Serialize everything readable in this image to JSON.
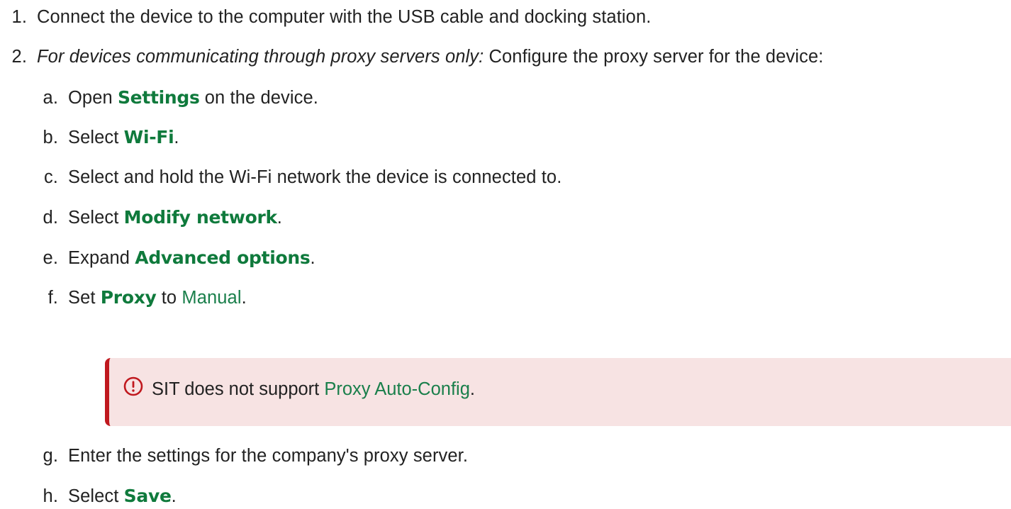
{
  "steps": [
    {
      "number": "1.",
      "text": "Connect the device to the computer with the USB cable and docking station."
    },
    {
      "number": "2.",
      "condition": "For devices communicating through proxy servers only:",
      "text": " Configure the proxy server for the device:",
      "substeps": [
        {
          "letter": "a.",
          "before": "Open ",
          "ui": "Settings",
          "after": " on the device."
        },
        {
          "letter": "b.",
          "before": "Select ",
          "ui": "Wi-Fi",
          "after": "."
        },
        {
          "letter": "c.",
          "text": "Select and hold the Wi-Fi network the device is connected to."
        },
        {
          "letter": "d.",
          "before": "Select ",
          "ui": "Modify network",
          "after": "."
        },
        {
          "letter": "e.",
          "before": "Expand ",
          "ui": "Advanced options",
          "after": "."
        },
        {
          "letter": "f.",
          "before": "Set ",
          "ui": "Proxy",
          "middle": " to ",
          "value": "Manual",
          "after": "."
        },
        {
          "letter": "g.",
          "text": "Enter the settings for the company's proxy server."
        },
        {
          "letter": "h.",
          "before": "Select ",
          "ui": "Save",
          "after": "."
        }
      ]
    }
  ],
  "callout": {
    "icon": "alert-circle-icon",
    "before": "SIT does not support ",
    "value": "Proxy Auto-Config",
    "after": ".",
    "accent_color": "#c0181e",
    "background_color": "#f7e3e3"
  },
  "colors": {
    "ui_term": "#0f7a3c",
    "value_term": "#1a7f4b",
    "body_text": "#222222"
  }
}
